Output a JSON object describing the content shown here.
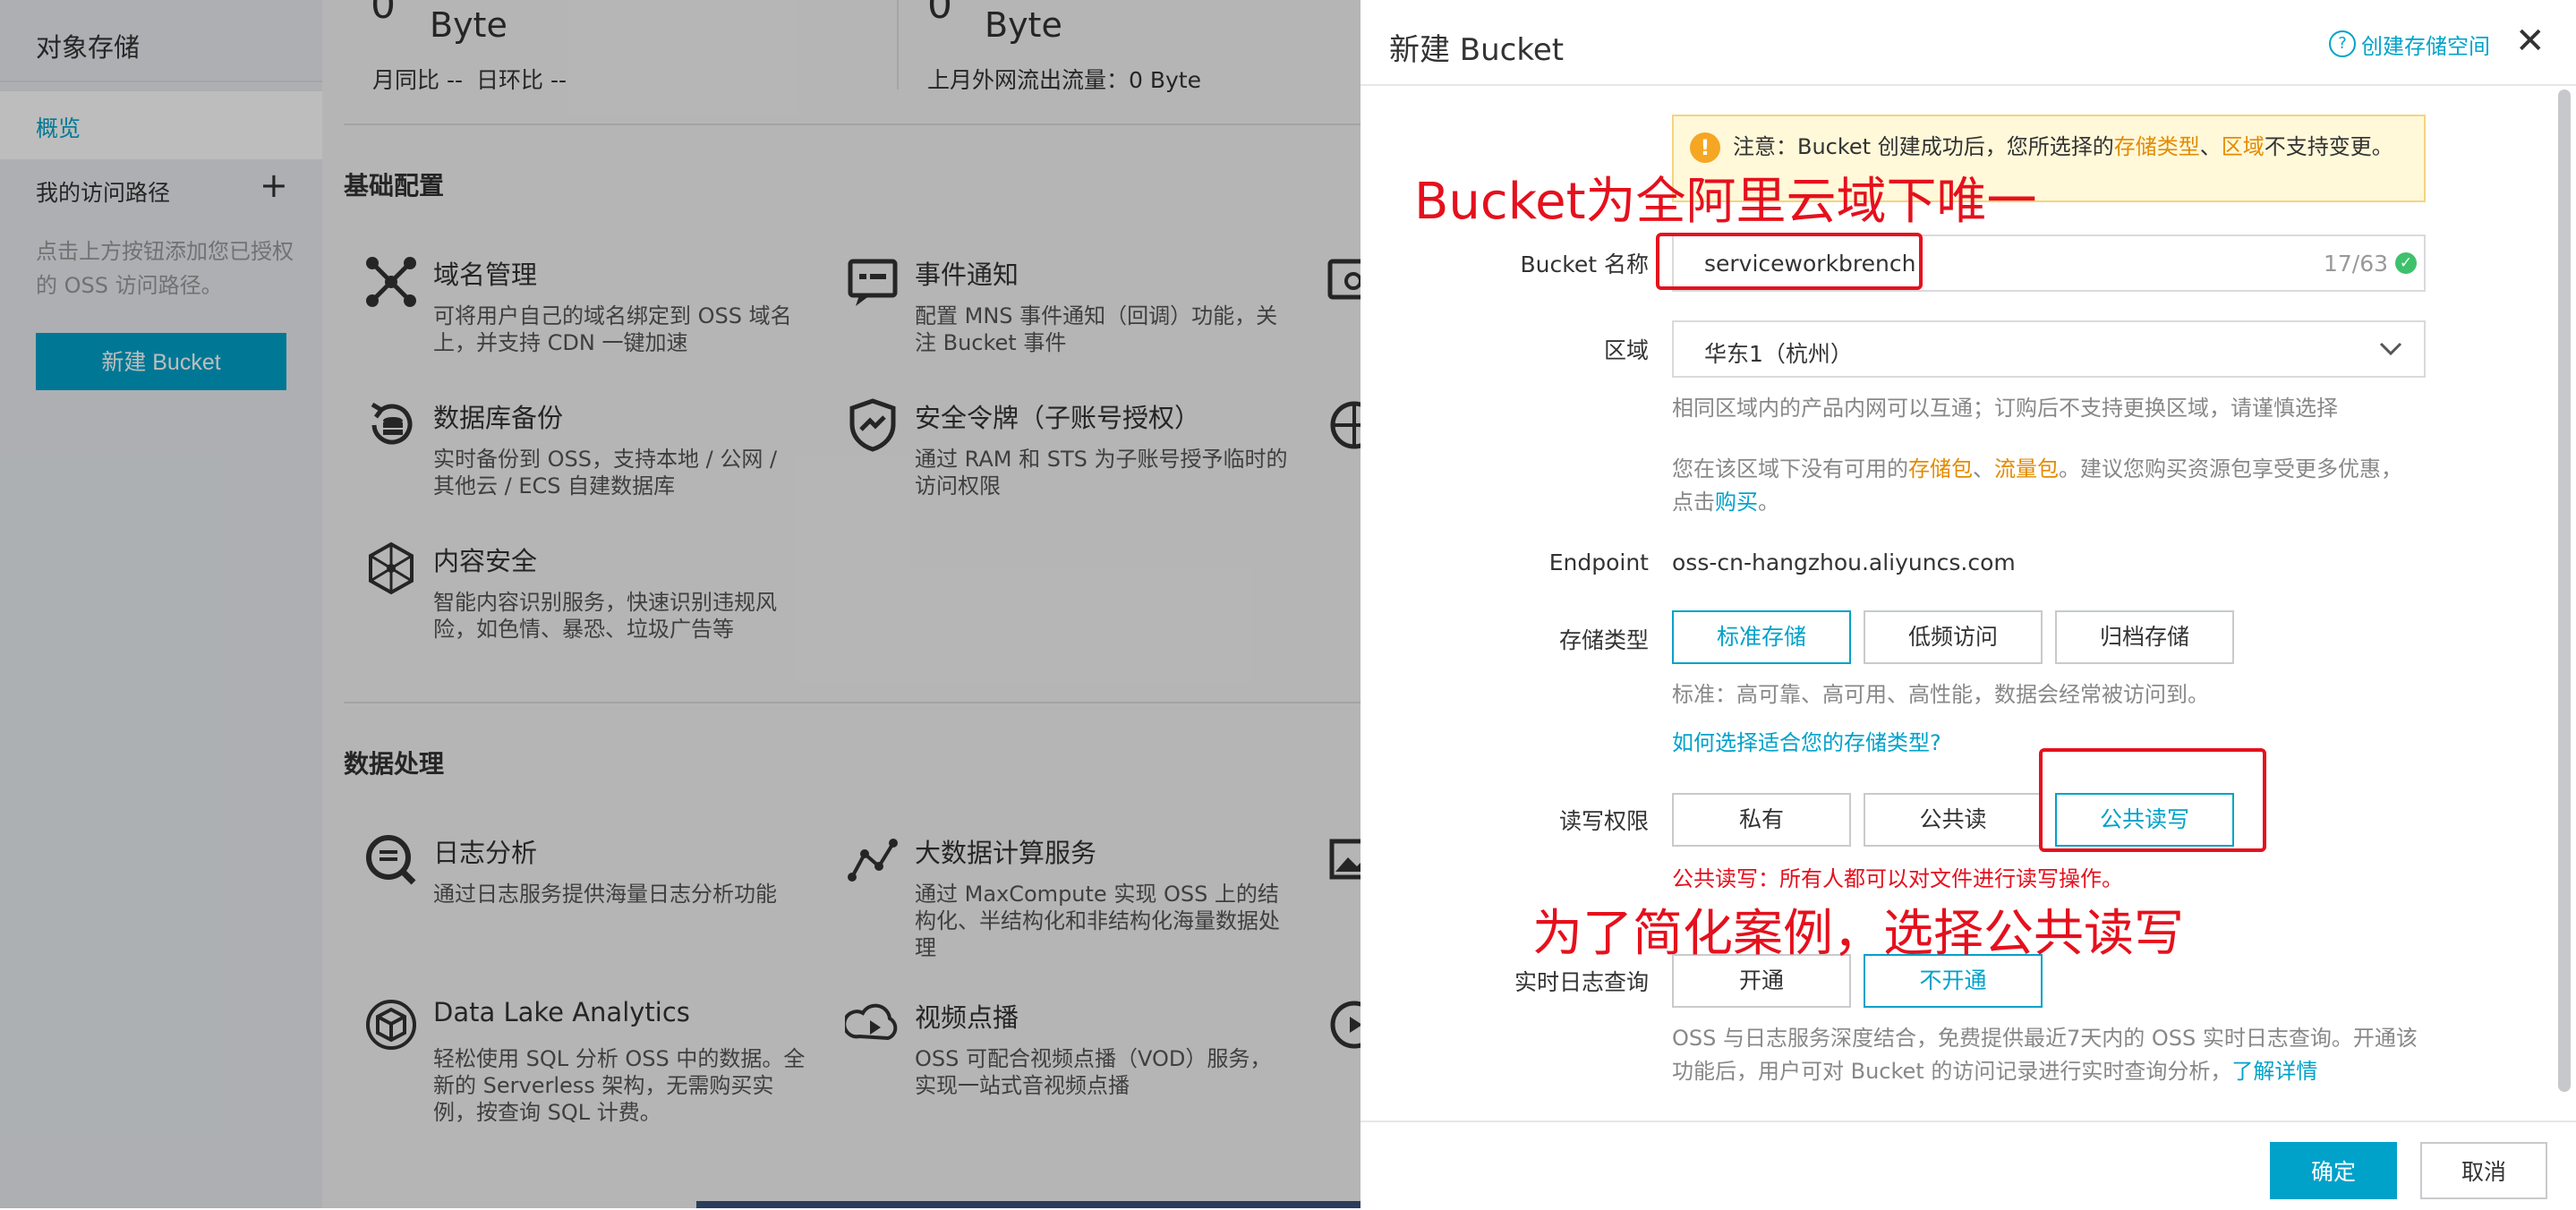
{
  "sidebar": {
    "title": "对象存储",
    "overview": "概览",
    "access_paths": "我的访问路径",
    "add_icon": "plus-icon",
    "hint": "点击上方按钮添加您已授权的 OSS 访问路径。",
    "new_bucket": "新建 Bucket"
  },
  "stats": {
    "left_value": "0",
    "left_unit": "Byte",
    "left_compare_mom": "月同比 --",
    "left_compare_dod": "日环比 --",
    "right_value": "0",
    "right_unit": "Byte",
    "right_label": "上月外网流出流量：0 Byte"
  },
  "basic_config": {
    "title": "基础配置",
    "items": [
      {
        "title": "域名管理",
        "desc": "可将用户自己的域名绑定到 OSS 域名上，并支持 CDN 一键加速",
        "icon": "domain-icon"
      },
      {
        "title": "事件通知",
        "desc": "配置 MNS 事件通知（回调）功能，关注 Bucket 事件",
        "icon": "event-icon"
      },
      {
        "title": "数据库备份",
        "desc": "实时备份到 OSS，支持本地 / 公网 / 其他云 / ECS 自建数据库",
        "icon": "backup-icon"
      },
      {
        "title": "安全令牌（子账号授权）",
        "desc": "通过 RAM 和 STS 为子账号授予临时的访问权限",
        "icon": "shield-icon"
      },
      {
        "title": "内容安全",
        "desc": "智能内容识别服务，快速识别违规风险，如色情、暴恐、垃圾广告等",
        "icon": "content-security-icon"
      }
    ]
  },
  "data_processing": {
    "title": "数据处理",
    "items": [
      {
        "title": "日志分析",
        "desc": "通过日志服务提供海量日志分析功能",
        "icon": "log-icon"
      },
      {
        "title": "大数据计算服务",
        "desc": "通过 MaxCompute 实现 OSS 上的结构化、半结构化和非结构化海量数据处理",
        "icon": "bigdata-icon"
      },
      {
        "title": "Data Lake Analytics",
        "desc": "轻松使用 SQL 分析 OSS 中的数据。全新的 Serverless 架构，无需购买实例，按查询 SQL 计费。",
        "icon": "dla-icon"
      },
      {
        "title": "视频点播",
        "desc": "OSS 可配合视频点播（VOD）服务，实现一站式音视频点播",
        "icon": "vod-icon"
      }
    ]
  },
  "drawer": {
    "title": "新建 Bucket",
    "help": "创建存储空间",
    "help_icon": "question-icon",
    "close_icon": "close-icon",
    "notice_prefix": "注意：Bucket 创建成功后，您所选择的",
    "notice_type": "存储类型",
    "notice_sep": "、",
    "notice_region": "区域",
    "notice_suffix": "不支持变更。",
    "name_label": "Bucket 名称",
    "name_value": "serviceworkbrench",
    "name_count": "17/63",
    "region_label": "区域",
    "region_value": "华东1（杭州）",
    "region_hint": "相同区域内的产品内网可以互通；订购后不支持更换区域，请谨慎选择",
    "pkg_hint_1": "您在该区域下没有可用的",
    "pkg_storage": "存储包",
    "pkg_sep": "、",
    "pkg_traffic": "流量包",
    "pkg_hint_2": "。建议您购买资源包享受更多优惠，",
    "pkg_hint_3": "点击",
    "pkg_buy": "购买",
    "pkg_hint_4": "。",
    "endpoint_label": "Endpoint",
    "endpoint_value": "oss-cn-hangzhou.aliyuncs.com",
    "storage_label": "存储类型",
    "storage_options": [
      "标准存储",
      "低频访问",
      "归档存储"
    ],
    "storage_selected": "标准存储",
    "storage_hint": "标准：高可靠、高可用、高性能，数据会经常被访问到。",
    "storage_link": "如何选择适合您的存储类型?",
    "acl_label": "读写权限",
    "acl_options": [
      "私有",
      "公共读",
      "公共读写"
    ],
    "acl_selected": "公共读写",
    "acl_warning": "公共读写：所有人都可以对文件进行读写操作。",
    "log_label": "实时日志查询",
    "log_options": [
      "开通",
      "不开通"
    ],
    "log_selected": "不开通",
    "log_hint_1": "OSS 与日志服务深度结合，免费提供最近7天内的 OSS 实时日志查询。开通该",
    "log_hint_2": "功能后，用户可对 Bucket 的访问记录进行实时查询分析，",
    "log_link": "了解详情",
    "ok": "确定",
    "cancel": "取消"
  },
  "annotations": {
    "name_note": "Bucket为全阿里云域下唯一",
    "acl_note": "为了简化案例，选择公共读写"
  },
  "colors": {
    "accent": "#00a2ca",
    "annotation_red": "#e5101d",
    "highlight_orange": "#e38b00"
  }
}
